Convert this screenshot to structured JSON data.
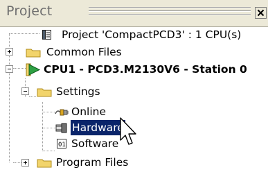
{
  "panel": {
    "title": "Project",
    "close_glyph": "✕"
  },
  "tree": {
    "project": {
      "label": "Project 'CompactPCD3' : 1 CPU(s)",
      "icon": "project-file-icon"
    },
    "common_files": {
      "label": "Common Files",
      "icon": "folder-icon",
      "expander": "+"
    },
    "cpu": {
      "label": "CPU1 - PCD3.M2130V6 - Station 0",
      "icon": "cpu-play-icon",
      "expander": "-"
    },
    "settings": {
      "label": "Settings",
      "icon": "folder-open-icon",
      "expander": "-"
    },
    "online": {
      "label": "Online",
      "icon": "online-plug-icon"
    },
    "hardware": {
      "label": "Hardware",
      "icon": "hardware-connector-icon",
      "selected": true
    },
    "software": {
      "label": "Software",
      "icon": "software-icon"
    },
    "program_files": {
      "label": "Program Files",
      "icon": "folder-icon",
      "expander": "+"
    }
  },
  "colors": {
    "selection": "#0a246a",
    "folder": "#f2d46b",
    "cpu_play": "#2ea043",
    "title_bar": "#ece9d8"
  },
  "cursor": "mouse-pointer-icon"
}
